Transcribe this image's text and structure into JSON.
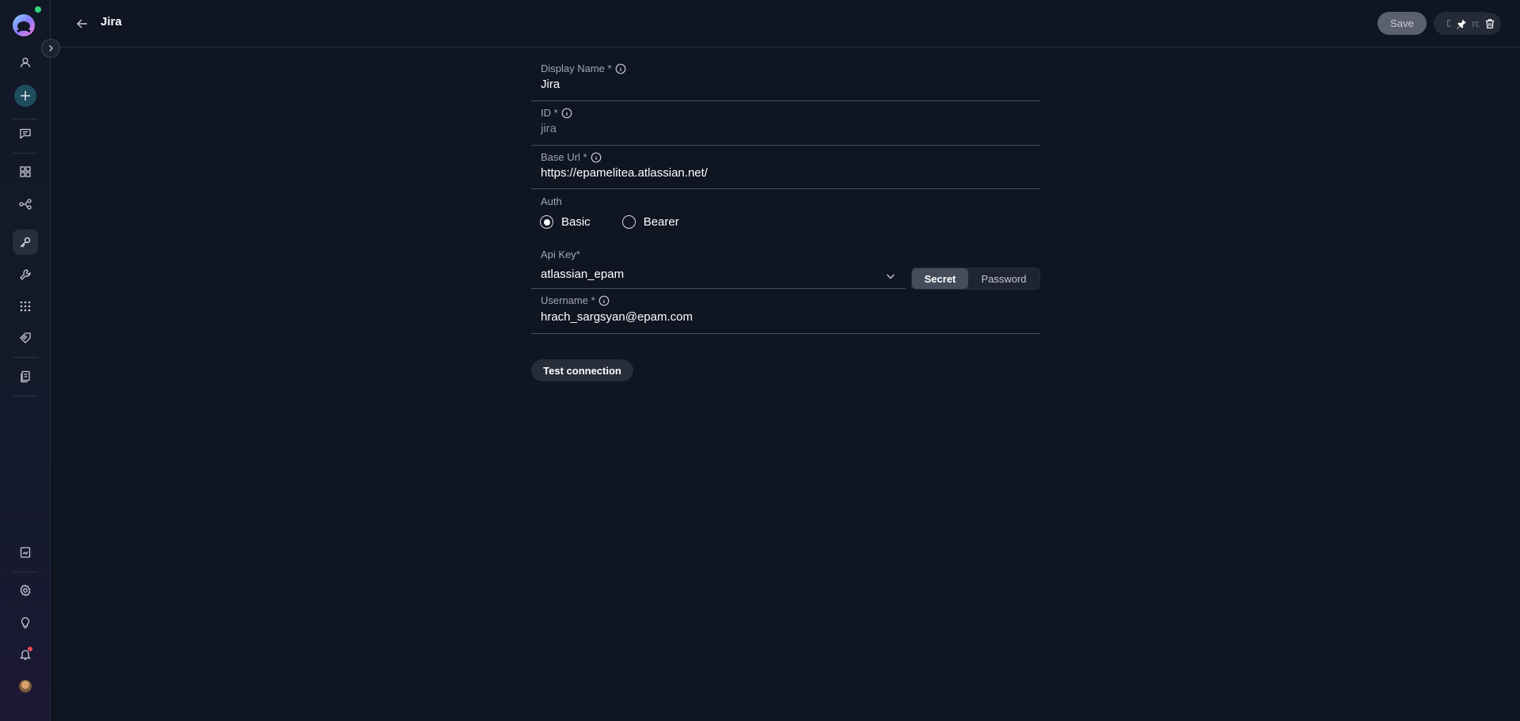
{
  "header": {
    "title": "Jira",
    "save_label": "Save",
    "discard_label": "Discard"
  },
  "form": {
    "display_name": {
      "label": "Display Name *",
      "value": "Jira"
    },
    "id": {
      "label": "ID *",
      "value": "jira"
    },
    "base_url": {
      "label": "Base Url *",
      "value": "https://epamelitea.atlassian.net/"
    },
    "auth": {
      "label": "Auth",
      "options": [
        "Basic",
        "Bearer"
      ],
      "selected": "Basic"
    },
    "api_key": {
      "label": "Api Key*",
      "value": "atlassian_epam",
      "modes": [
        "Secret",
        "Password"
      ],
      "selected_mode": "Secret"
    },
    "username": {
      "label": "Username *",
      "value": "hrach_sargsyan@epam.com"
    },
    "test_connection_label": "Test connection"
  },
  "sidebar": {
    "icons": [
      "user-icon",
      "plus-icon",
      "chat-icon",
      "grid-icon",
      "flow-icon",
      "key-icon",
      "wrench-icon",
      "apps-icon",
      "tag-icon",
      "documents-icon",
      "report-icon",
      "settings-icon",
      "lightbulb-icon",
      "bell-icon",
      "avatar"
    ]
  },
  "colors": {
    "background": "#0f1521",
    "accent": "#1f4d5e",
    "online": "#2ed47a",
    "notification": "#e84a5f"
  }
}
